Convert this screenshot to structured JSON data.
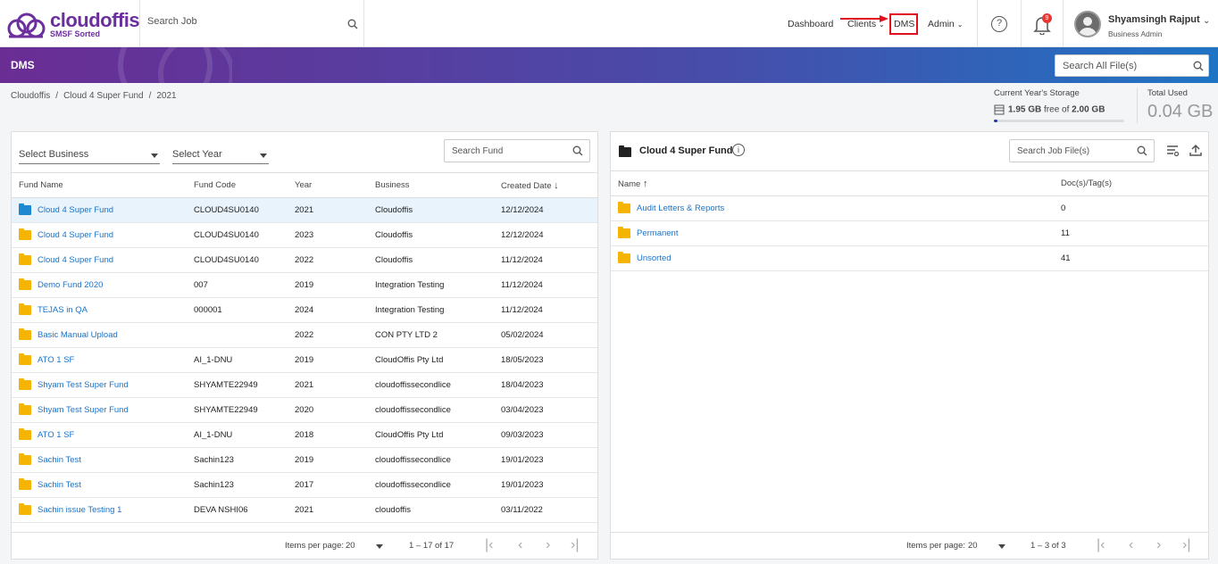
{
  "brand": {
    "name": "cloudoffis",
    "tagline": "SMSF Sorted",
    "color": "#6b2f9e"
  },
  "header": {
    "search_placeholder": "Search Job",
    "nav": [
      {
        "label": "Dashboard"
      },
      {
        "label": "Clients"
      },
      {
        "label": "DMS"
      },
      {
        "label": "Admin"
      }
    ],
    "notification_count": "9",
    "user": {
      "name": "Shyamsingh Rajput",
      "role": "Business Admin"
    }
  },
  "banner": {
    "title": "DMS",
    "search_placeholder": "Search All File(s)"
  },
  "breadcrumb": [
    "Cloudoffis",
    "/",
    "Cloud 4 Super Fund",
    "/",
    "2021"
  ],
  "storage": {
    "label": "Current Year's Storage",
    "used": "1.95 GB",
    "free_text": "free of",
    "total": "2.00 GB",
    "used_fraction": 0.03
  },
  "total_used": {
    "label": "Total Used",
    "value": "0.04 GB"
  },
  "left": {
    "select_business": "Select Business",
    "select_year": "Select Year",
    "search_placeholder": "Search Fund",
    "columns": [
      "Fund Name",
      "Fund Code",
      "Year",
      "Business",
      "Created Date"
    ],
    "rows": [
      {
        "name": "Cloud 4 Super Fund",
        "code": "CLOUD4SU0140",
        "year": "2021",
        "business": "Cloudoffis",
        "date": "12/12/2024"
      },
      {
        "name": "Cloud 4 Super Fund",
        "code": "CLOUD4SU0140",
        "year": "2023",
        "business": "Cloudoffis",
        "date": "12/12/2024"
      },
      {
        "name": "Cloud 4 Super Fund",
        "code": "CLOUD4SU0140",
        "year": "2022",
        "business": "Cloudoffis",
        "date": "11/12/2024"
      },
      {
        "name": "Demo Fund 2020",
        "code": "007",
        "year": "2019",
        "business": "Integration Testing",
        "date": "11/12/2024"
      },
      {
        "name": "TEJAS in QA",
        "code": "000001",
        "year": "2024",
        "business": "Integration Testing",
        "date": "11/12/2024"
      },
      {
        "name": "Basic Manual Upload",
        "code": "",
        "year": "2022",
        "business": "CON PTY LTD 2",
        "date": "05/02/2024"
      },
      {
        "name": "ATO 1 SF",
        "code": "AI_1-DNU",
        "year": "2019",
        "business": "CloudOffis Pty Ltd",
        "date": "18/05/2023"
      },
      {
        "name": "Shyam Test Super Fund",
        "code": "SHYAMTE22949",
        "year": "2021",
        "business": "cloudoffissecondlice",
        "date": "18/04/2023"
      },
      {
        "name": "Shyam Test Super Fund",
        "code": "SHYAMTE22949",
        "year": "2020",
        "business": "cloudoffissecondlice",
        "date": "03/04/2023"
      },
      {
        "name": "ATO 1 SF",
        "code": "AI_1-DNU",
        "year": "2018",
        "business": "CloudOffis Pty Ltd",
        "date": "09/03/2023"
      },
      {
        "name": "Sachin Test",
        "code": "Sachin123",
        "year": "2019",
        "business": "cloudoffissecondlice",
        "date": "19/01/2023"
      },
      {
        "name": "Sachin Test",
        "code": "Sachin123",
        "year": "2017",
        "business": "cloudoffissecondlice",
        "date": "19/01/2023"
      },
      {
        "name": "Sachin issue Testing 1",
        "code": "DEVA NSHI06",
        "year": "2021",
        "business": "cloudoffis",
        "date": "03/11/2022"
      }
    ],
    "pager": {
      "label": "Items per page:",
      "size": "20",
      "range": "1 – 17 of 17"
    }
  },
  "right": {
    "title": "Cloud 4 Super Fund",
    "search_placeholder": "Search Job File(s)",
    "columns": [
      "Name",
      "Doc(s)/Tag(s)"
    ],
    "rows": [
      {
        "name": "Audit Letters & Reports",
        "count": "0"
      },
      {
        "name": "Permanent",
        "count": "11"
      },
      {
        "name": "Unsorted",
        "count": "41"
      }
    ],
    "pager": {
      "label": "Items per page:",
      "size": "20",
      "range": "1 – 3 of 3"
    }
  }
}
